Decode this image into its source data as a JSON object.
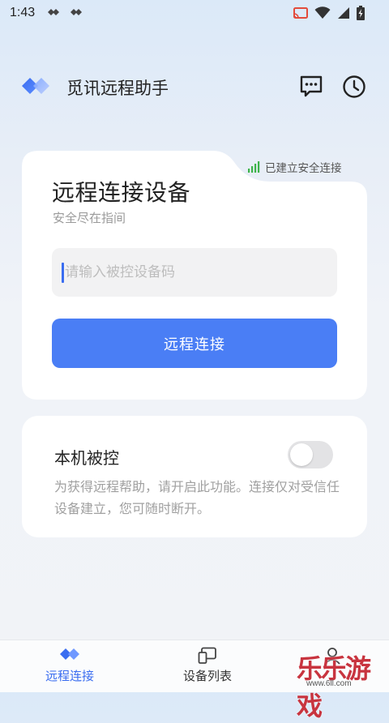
{
  "status_bar": {
    "time": "1:43",
    "icons": [
      "nav-diamond-icon",
      "nav-diamond-icon",
      "cast-icon",
      "wifi-icon",
      "signal-icon",
      "battery-charging-icon"
    ]
  },
  "app_bar": {
    "title": "觅讯远程助手",
    "logo_icon": "double-diamond-logo",
    "actions": [
      "chat-icon",
      "history-clock-icon"
    ]
  },
  "connect_card": {
    "secure_status": "已建立安全连接",
    "title": "远程连接设备",
    "subtitle": "安全尽在指间",
    "input": {
      "placeholder": "请输入被控设备码",
      "value": ""
    },
    "button_label": "远程连接"
  },
  "controlled_card": {
    "title": "本机被控",
    "toggle_on": false,
    "description": "为获得远程帮助，请开启此功能。连接仅对受信任设备建立，您可随时断开。"
  },
  "bottom_nav": {
    "items": [
      {
        "label": "远程连接",
        "icon": "double-diamond-icon",
        "active": true
      },
      {
        "label": "设备列表",
        "icon": "devices-icon",
        "active": false
      },
      {
        "label": "",
        "icon": "profile-icon",
        "active": false
      }
    ]
  },
  "watermark": {
    "text": "乐乐游戏",
    "url": "www.6ll.com"
  },
  "colors": {
    "accent": "#4A7EF5",
    "signal_green": "#3DB34A",
    "card_bg": "#FFFFFF"
  }
}
